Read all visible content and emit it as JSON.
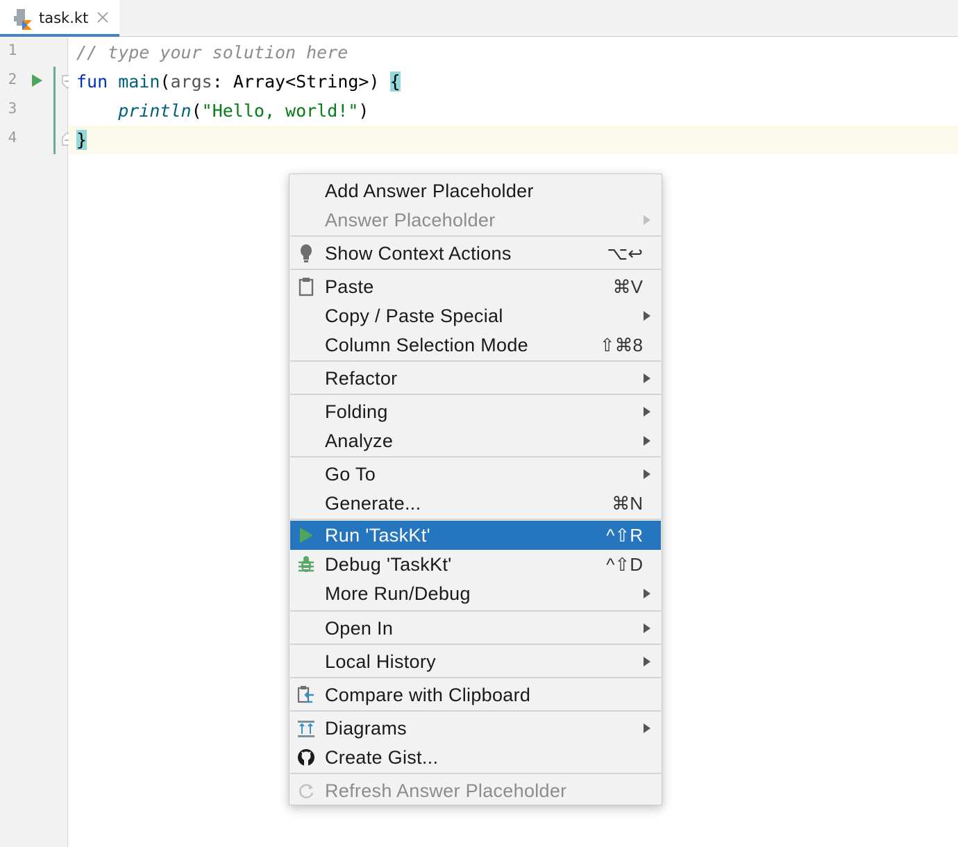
{
  "tab": {
    "label": "task.kt"
  },
  "gutter": {
    "lines": [
      "1",
      "2",
      "3",
      "4"
    ]
  },
  "code": {
    "line1": {
      "comment": "// type your solution here"
    },
    "line2": {
      "kw": "fun",
      "fn": " main",
      "open": "(",
      "param": "args",
      "colon": ": ",
      "type": "Array<String>",
      "close": ") ",
      "brace": "{"
    },
    "line3": {
      "indent": "    ",
      "call": "println",
      "open": "(",
      "str": "\"Hello, world!\"",
      "close": ")"
    },
    "line4": {
      "brace": "}"
    }
  },
  "menu": {
    "add_answer_placeholder": "Add Answer Placeholder",
    "answer_placeholder": "Answer Placeholder",
    "show_context_actions": {
      "label": "Show Context Actions",
      "shortcut": "⌥↩"
    },
    "paste": {
      "label": "Paste",
      "shortcut": "⌘V"
    },
    "copy_paste_special": "Copy / Paste Special",
    "column_selection_mode": {
      "label": "Column Selection Mode",
      "shortcut": "⇧⌘8"
    },
    "refactor": "Refactor",
    "folding": "Folding",
    "analyze": "Analyze",
    "go_to": "Go To",
    "generate": {
      "label": "Generate...",
      "shortcut": "⌘N"
    },
    "run": {
      "label": "Run 'TaskKt'",
      "shortcut": "^⇧R"
    },
    "debug": {
      "label": "Debug 'TaskKt'",
      "shortcut": "^⇧D"
    },
    "more_run_debug": "More Run/Debug",
    "open_in": "Open In",
    "local_history": "Local History",
    "compare_with_clipboard": "Compare with Clipboard",
    "diagrams": "Diagrams",
    "create_gist": "Create Gist...",
    "refresh_answer_placeholder": "Refresh Answer Placeholder"
  },
  "colors": {
    "selection": "#2675bf",
    "run_green": "#4fa65a",
    "menu_bg": "#f2f2f2",
    "tab_underline": "#4083c9"
  }
}
